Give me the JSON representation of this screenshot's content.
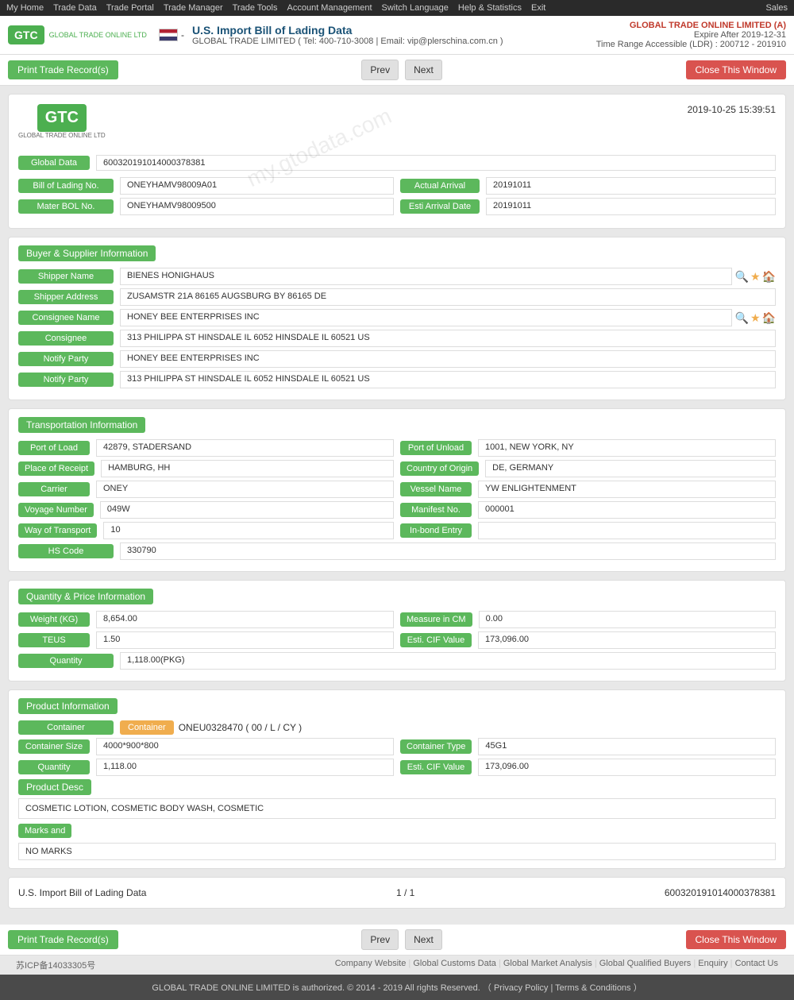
{
  "topnav": {
    "items": [
      "My Home",
      "Trade Data",
      "Trade Portal",
      "Trade Manager",
      "Trade Tools",
      "Account Management",
      "Switch Language",
      "Help & Statistics",
      "Exit",
      "Sales"
    ]
  },
  "header": {
    "logo_text": "GTC",
    "logo_sub": "GLOBAL TRADE ONLINE LTD",
    "flag_label": "US Flag",
    "page_title": "U.S. Import Bill of Lading Data",
    "contact": "GLOBAL TRADE LIMITED ( Tel: 400-710-3008 | Email: vip@plerschina.com.cn )",
    "company_name": "GLOBAL TRADE ONLINE LIMITED (A)",
    "expire": "Expire After 2019-12-31",
    "time_range": "Time Range Accessible (LDR) : 200712 - 201910"
  },
  "toolbar": {
    "print_label": "Print Trade Record(s)",
    "prev_label": "Prev",
    "next_label": "Next",
    "close_label": "Close This Window"
  },
  "card": {
    "timestamp": "2019-10-25 15:39:51",
    "global_data_label": "Global Data",
    "global_data_value": "600320191014000378381",
    "bol_label": "Bill of Lading No.",
    "bol_value": "ONEYHAMV98009A01",
    "actual_arrival_label": "Actual Arrival",
    "actual_arrival_value": "20191011",
    "master_bol_label": "Mater BOL No.",
    "master_bol_value": "ONEYHAMV98009500",
    "esti_arrival_label": "Esti Arrival Date",
    "esti_arrival_value": "20191011"
  },
  "buyer_supplier": {
    "section_title": "Buyer & Supplier Information",
    "shipper_name_label": "Shipper Name",
    "shipper_name_value": "BIENES HONIGHAUS",
    "shipper_address_label": "Shipper Address",
    "shipper_address_value": "ZUSAMSTR 21A 86165 AUGSBURG BY 86165 DE",
    "consignee_name_label": "Consignee Name",
    "consignee_name_value": "HONEY BEE ENTERPRISES INC",
    "consignee_label": "Consignee",
    "consignee_value": "313 PHILIPPA ST HINSDALE IL 6052 HINSDALE IL 60521 US",
    "notify_party_label": "Notify Party",
    "notify_party_value": "HONEY BEE ENTERPRISES INC",
    "notify_party2_label": "Notify Party",
    "notify_party2_value": "313 PHILIPPA ST HINSDALE IL 6052 HINSDALE IL 60521 US"
  },
  "transportation": {
    "section_title": "Transportation Information",
    "port_load_label": "Port of Load",
    "port_load_value": "42879, STADERSAND",
    "port_unload_label": "Port of Unload",
    "port_unload_value": "1001, NEW YORK, NY",
    "place_receipt_label": "Place of Receipt",
    "place_receipt_value": "HAMBURG, HH",
    "country_origin_label": "Country of Origin",
    "country_origin_value": "DE, GERMANY",
    "carrier_label": "Carrier",
    "carrier_value": "ONEY",
    "vessel_name_label": "Vessel Name",
    "vessel_name_value": "YW ENLIGHTENMENT",
    "voyage_label": "Voyage Number",
    "voyage_value": "049W",
    "manifest_label": "Manifest No.",
    "manifest_value": "000001",
    "way_transport_label": "Way of Transport",
    "way_transport_value": "10",
    "inbond_label": "In-bond Entry",
    "inbond_value": "",
    "hs_code_label": "HS Code",
    "hs_code_value": "330790"
  },
  "quantity_price": {
    "section_title": "Quantity & Price Information",
    "weight_label": "Weight (KG)",
    "weight_value": "8,654.00",
    "measure_label": "Measure in CM",
    "measure_value": "0.00",
    "teus_label": "TEUS",
    "teus_value": "1.50",
    "esti_cif_label": "Esti. CIF Value",
    "esti_cif_value": "173,096.00",
    "quantity_label": "Quantity",
    "quantity_value": "1,118.00(PKG)"
  },
  "product_info": {
    "section_title": "Product Information",
    "container_label": "Container",
    "container_value": "ONEU0328470 ( 00 / L / CY )",
    "container_size_label": "Container Size",
    "container_size_value": "4000*900*800",
    "container_type_label": "Container Type",
    "container_type_value": "45G1",
    "quantity_label": "Quantity",
    "quantity_value": "1,118.00",
    "esti_cif_label": "Esti. CIF Value",
    "esti_cif_value": "173,096.00",
    "product_desc_label": "Product Desc",
    "product_desc_value": "COSMETIC LOTION, COSMETIC BODY WASH, COSMETIC",
    "marks_label": "Marks and",
    "marks_value": "NO MARKS"
  },
  "footer_card": {
    "left_text": "U.S. Import Bill of Lading Data",
    "pagination": "1 / 1",
    "right_text": "600320191014000378381"
  },
  "bottom_toolbar": {
    "print_label": "Print Trade Record(s)",
    "prev_label": "Prev",
    "next_label": "Next",
    "close_label": "Close This Window"
  },
  "icp": {
    "icp_text": "苏ICP备14033305号",
    "links": [
      "Company Website",
      "Global Customs Data",
      "Global Market Analysis",
      "Global Qualified Buyers",
      "Enquiry",
      "Contact Us"
    ],
    "copyright": "GLOBAL TRADE ONLINE LIMITED is authorized. © 2014 - 2019 All rights Reserved.  （ Privacy Policy | Terms & Conditions ）"
  },
  "watermark": "my.gtodata.com"
}
